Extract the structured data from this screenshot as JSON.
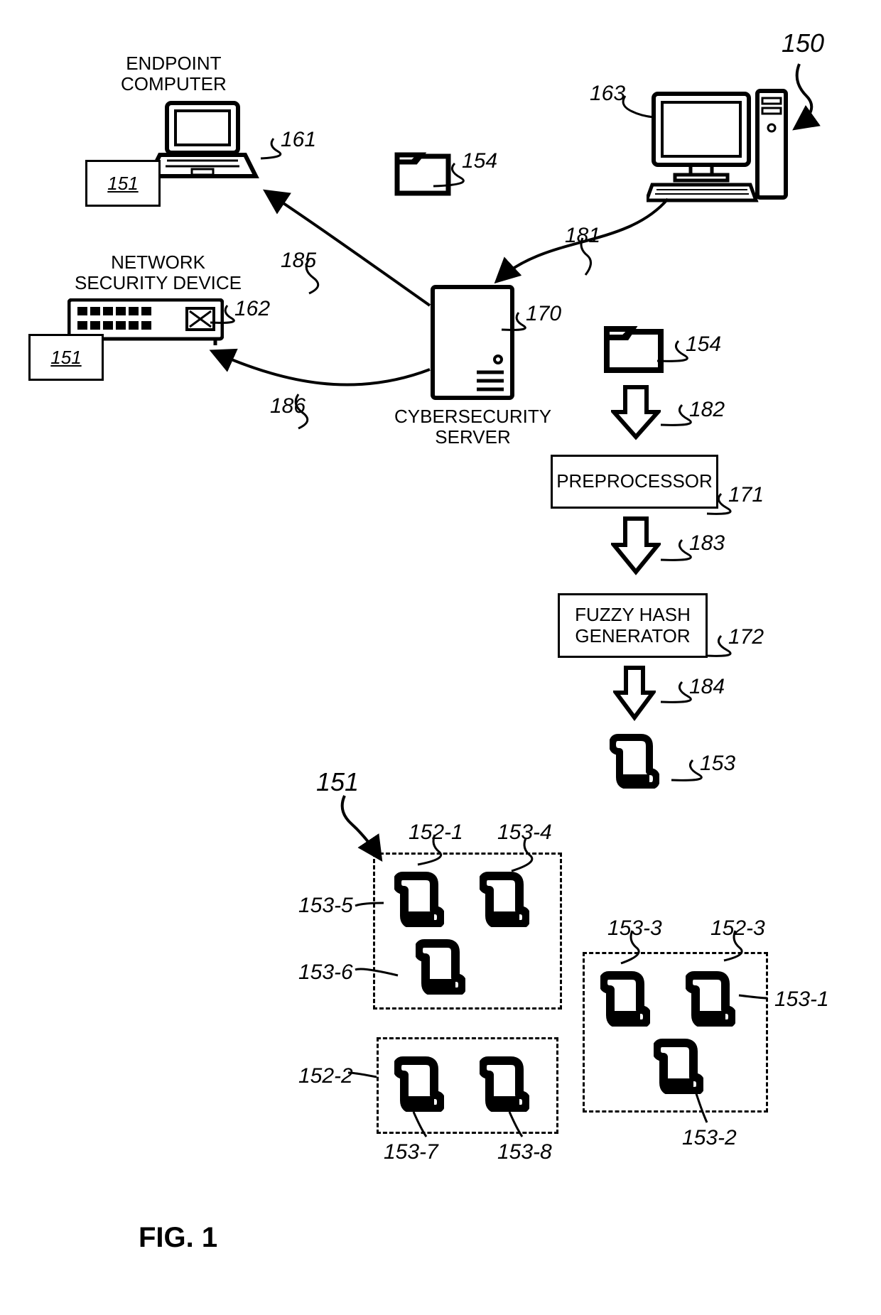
{
  "figure_number": "FIG. 1",
  "system_ref": "150",
  "labels": {
    "endpoint_computer": "ENDPOINT\nCOMPUTER",
    "network_security_device": "NETWORK\nSECURITY DEVICE",
    "cybersecurity_server": "CYBERSECURITY\nSERVER"
  },
  "boxes": {
    "preprocessor": "PREPROCESSOR",
    "fuzzy_hash_generator": "FUZZY HASH\nGENERATOR"
  },
  "small_module": "151",
  "refs": {
    "r161": "161",
    "r162": "162",
    "r163": "163",
    "r170": "170",
    "r171": "171",
    "r172": "172",
    "r181": "181",
    "r182": "182",
    "r183": "183",
    "r184": "184",
    "r185": "185",
    "r186": "186",
    "r151_a": "151",
    "r151_b": "151",
    "r151_c": "151",
    "r152_1": "152-1",
    "r152_2": "152-2",
    "r152_3": "152-3",
    "r153": "153",
    "r153_1": "153-1",
    "r153_2": "153-2",
    "r153_3": "153-3",
    "r153_4": "153-4",
    "r153_5": "153-5",
    "r153_6": "153-6",
    "r153_7": "153-7",
    "r153_8": "153-8",
    "r154_a": "154",
    "r154_b": "154"
  }
}
